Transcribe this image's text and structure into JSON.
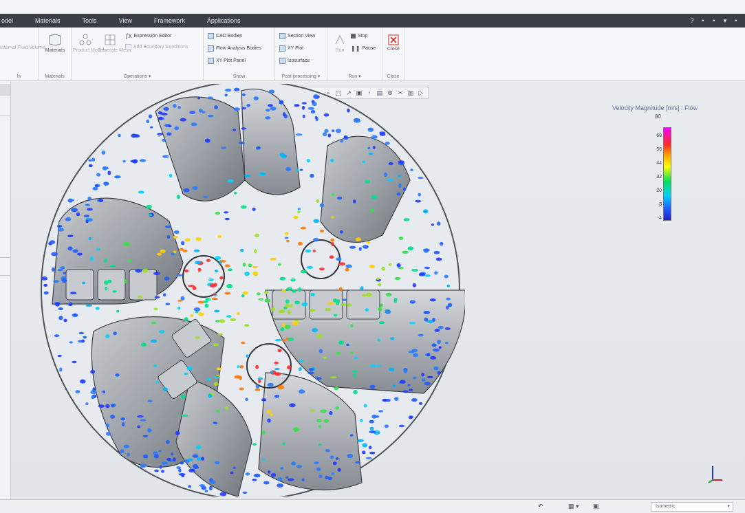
{
  "menu": {
    "items": [
      "odel",
      "Materials",
      "Tools",
      "View",
      "Framework",
      "Applications"
    ]
  },
  "window_controls": [
    "?",
    "•",
    "•",
    "▾",
    "•"
  ],
  "ribbon": {
    "groups": {
      "g0": {
        "label": "ls",
        "btn": "Internal Fluid Volume"
      },
      "materials": {
        "label": "Materials",
        "btn": "Materials"
      },
      "operations": {
        "label": "Operations ▾",
        "btn_product": "Product Models",
        "btn_generate": "Generate Mesh",
        "expression": "Expression Editor",
        "add_boundary": "Add Boundary Conditions"
      },
      "show": {
        "label": "Show",
        "cad_bodies": "CAD Bodies",
        "flow_analysis": "Flow Analysis Bodies",
        "xyplot_panel": "XY Plot Panel"
      },
      "post": {
        "label": "Post-processing ▾",
        "section_view": "Section View",
        "xy_plot": "XY Plot",
        "isosurface": "Isosurface"
      },
      "run": {
        "label": "Run ▾",
        "run": "Run",
        "stop": "Stop",
        "pause": "Pause"
      },
      "close": {
        "label": "Close",
        "btn": "Close"
      }
    }
  },
  "viewport_tools": [
    "⊕",
    "⌕",
    "⌕",
    "▢",
    "↗",
    "▣",
    "↑",
    "▤",
    "⚙",
    "✂",
    "▥",
    "▷"
  ],
  "legend": {
    "title": "Velocity Magnitude  [m/s] : Flow",
    "max": "80",
    "ticks": [
      "68",
      "56",
      "44",
      "32",
      "20",
      "8",
      "-4"
    ]
  },
  "status": {
    "icons": [
      "↶",
      "▦ ▾",
      "▣"
    ],
    "view_select": "Isometric"
  },
  "colors": {
    "menu_bg": "#3b4046",
    "accent": "#5a6f96",
    "close_red": "#d02020"
  }
}
